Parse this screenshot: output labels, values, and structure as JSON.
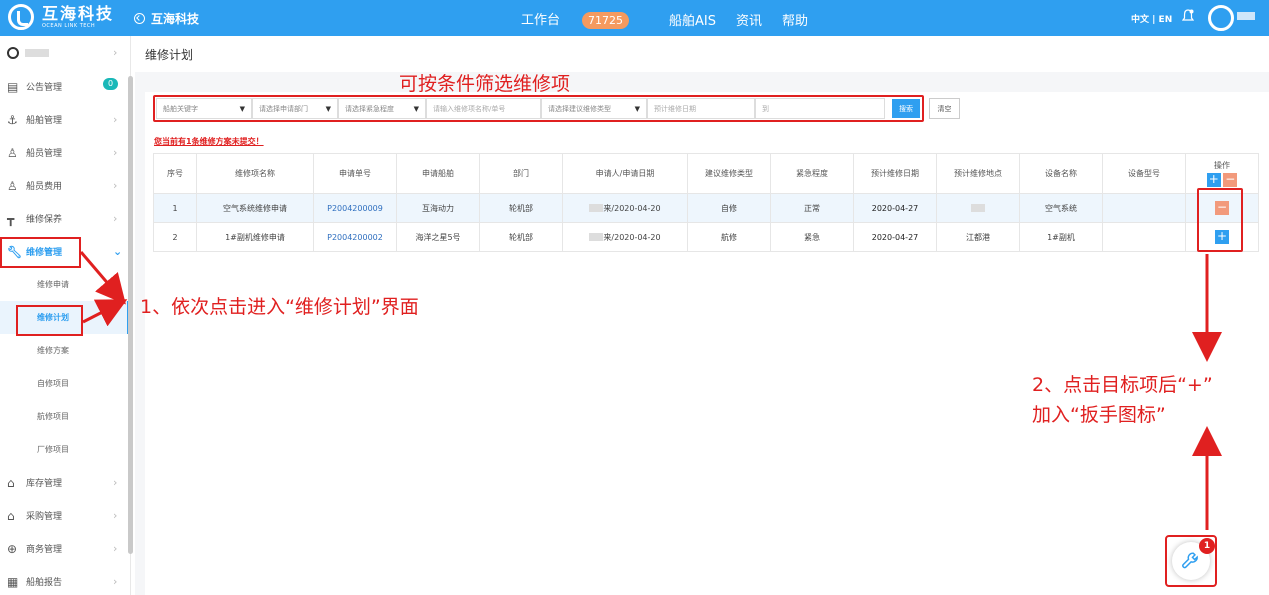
{
  "topbar": {
    "brand_cn": "互海科技",
    "brand_en": "OCEAN LINK TECH",
    "company": "互海科技",
    "nav": [
      {
        "label": "工作台",
        "badge": "71725"
      },
      {
        "label": "船舶AIS"
      },
      {
        "label": "资讯"
      },
      {
        "label": "帮助"
      }
    ],
    "lang": "中文 | EN",
    "accent": "#2f9ff0"
  },
  "sidebar": {
    "items": [
      {
        "label": "公告管理",
        "icon": "notice-icon",
        "badge": "0"
      },
      {
        "label": "船舶管理",
        "icon": "anchor-icon"
      },
      {
        "label": "船员管理",
        "icon": "person-icon"
      },
      {
        "label": "船员费用",
        "icon": "person-icon"
      },
      {
        "label": "维修保养",
        "icon": "tool-icon"
      },
      {
        "label": "维修管理",
        "icon": "wrench-icon",
        "active": true
      },
      {
        "label": "库存管理",
        "icon": "box-icon"
      },
      {
        "label": "采购管理",
        "icon": "box-icon"
      },
      {
        "label": "商务管理",
        "icon": "globe-icon"
      },
      {
        "label": "船舶报告",
        "icon": "report-icon"
      }
    ],
    "subitems": [
      "维修申请",
      "维修计划",
      "维修方案",
      "自修项目",
      "航修项目",
      "厂修项目"
    ]
  },
  "page": {
    "title": "维修计划",
    "filters": {
      "ship": "船舶关键字",
      "dept": "请选择申请部门",
      "urgency": "请选择紧急程度",
      "keyword": "请输入维修项名称/单号",
      "type": "请选择建议维修类型",
      "date_from": "预计维修日期",
      "date_to": "到"
    },
    "search_label": "搜索",
    "clear_label": "清空",
    "notice": "您当前有1条维修方案未提交！"
  },
  "table": {
    "headers": [
      "序号",
      "维修项名称",
      "申请单号",
      "申请船舶",
      "部门",
      "申请人/申请日期",
      "建议维修类型",
      "紧急程度",
      "预计维修日期",
      "预计维修地点",
      "设备名称",
      "设备型号",
      "操作"
    ],
    "rows": [
      {
        "no": "1",
        "name": "空气系统维修申请",
        "order": "P2004200009",
        "ship": "互海动力",
        "dept": "轮机部",
        "applicant": "来/2020-04-20",
        "type": "自修",
        "urgency": "正常",
        "date": "2020-04-27",
        "place": "",
        "equip": "空气系统",
        "model": ""
      },
      {
        "no": "2",
        "name": "1#副机维修申请",
        "order": "P2004200002",
        "ship": "海洋之星5号",
        "dept": "轮机部",
        "applicant": "来/2020-04-20",
        "type": "航修",
        "urgency": "紧急",
        "date": "2020-04-27",
        "place": "江都港",
        "equip": "1#副机",
        "model": ""
      }
    ]
  },
  "annotations": {
    "filter_hint": "可按条件筛选维修项",
    "step1": "1、依次点击进入“维修计划”界面",
    "step2_line1": "2、点击目标项后“+”",
    "step2_line2": "加入“扳手图标”",
    "color": "#e02020"
  },
  "wrench_badge": "1"
}
